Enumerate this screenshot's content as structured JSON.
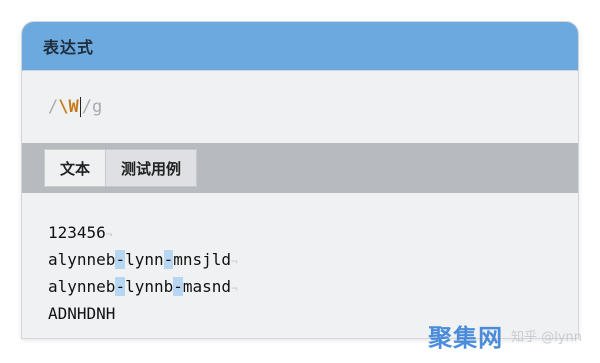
{
  "window": {
    "title": "表达式"
  },
  "regex": {
    "delimiter_open": "/",
    "pattern": "\\W",
    "delimiter_close": "/",
    "flags": "g"
  },
  "tabs": [
    {
      "label": "文本",
      "active": true
    },
    {
      "label": "测试用例",
      "active": false
    }
  ],
  "text": {
    "line1": "123456",
    "line2_parts": [
      "alynneb",
      "-",
      "lynn",
      "-",
      "mnsjld"
    ],
    "line3_parts": [
      "alynneb",
      "-",
      "lynnb",
      "-",
      "masnd"
    ],
    "line4": "ADNHDNH",
    "eol_marker": "¬"
  },
  "watermark": {
    "logo": "聚集网",
    "text": "知乎 @lynn"
  },
  "colors": {
    "header": "#6ba9de",
    "match_highlight": "#b7d6f2",
    "escape_token": "#c57a1b"
  }
}
